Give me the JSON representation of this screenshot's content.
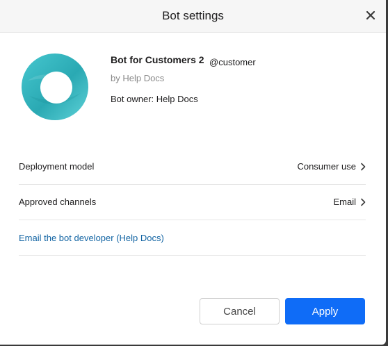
{
  "dialog": {
    "title": "Bot settings",
    "close_icon": "close-icon"
  },
  "bot": {
    "avatar_icon": "ring-logo-icon",
    "avatar_color": "#2bb3bd",
    "name": "Bot for Customers 2",
    "handle": "@customer",
    "byline": "by Help Docs",
    "owner": "Bot owner: Help Docs"
  },
  "settings": [
    {
      "label": "Deployment model",
      "value": "Consumer use",
      "icon": "chevron-right-icon"
    },
    {
      "label": "Approved channels",
      "value": "Email",
      "icon": "chevron-right-icon"
    }
  ],
  "developer_link": "Email the bot developer (Help Docs)",
  "buttons": {
    "cancel": "Cancel",
    "apply": "Apply"
  },
  "colors": {
    "accent": "#0f6cf7",
    "link": "#1264a3"
  }
}
